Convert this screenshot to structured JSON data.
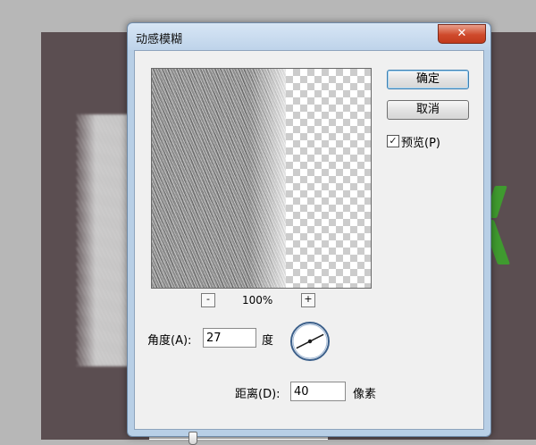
{
  "dialog": {
    "title": "动感模糊",
    "close_label": "✕"
  },
  "buttons": {
    "ok_label": "确定",
    "cancel_label": "取消"
  },
  "preview_toggle": {
    "label": "预览(P)",
    "checked": true
  },
  "zoom": {
    "out_label": "-",
    "in_label": "+",
    "level": "100%"
  },
  "angle": {
    "label": "角度(A):",
    "value": "27",
    "unit": "度"
  },
  "distance": {
    "label": "距离(D):",
    "value": "40",
    "unit": "像素"
  },
  "colors": {
    "canvas": "#5b4e51",
    "accent_green": "#3f9a2f",
    "dialog_frame": "#b8cfe6",
    "close_button": "#cf4a2c"
  }
}
